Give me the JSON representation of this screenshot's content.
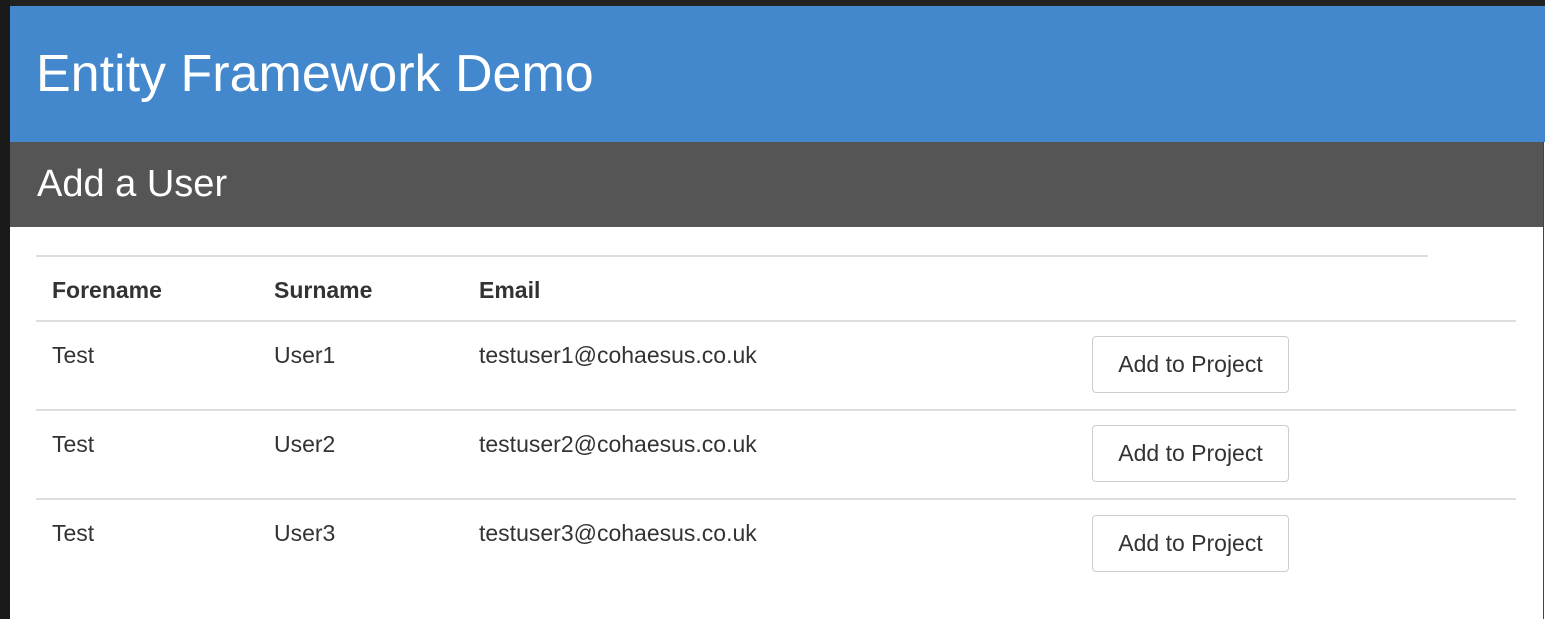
{
  "header": {
    "title": "Entity Framework Demo"
  },
  "panel": {
    "title": "Add a User"
  },
  "table": {
    "columns": [
      "Forename",
      "Surname",
      "Email"
    ],
    "rows": [
      {
        "forename": "Test",
        "surname": "User1",
        "email": "testuser1@cohaesus.co.uk",
        "action": "Add to Project"
      },
      {
        "forename": "Test",
        "surname": "User2",
        "email": "testuser2@cohaesus.co.uk",
        "action": "Add to Project"
      },
      {
        "forename": "Test",
        "surname": "User3",
        "email": "testuser3@cohaesus.co.uk",
        "action": "Add to Project"
      }
    ]
  },
  "colors": {
    "header_bg": "#4388cc",
    "panel_heading_bg": "#555555"
  }
}
